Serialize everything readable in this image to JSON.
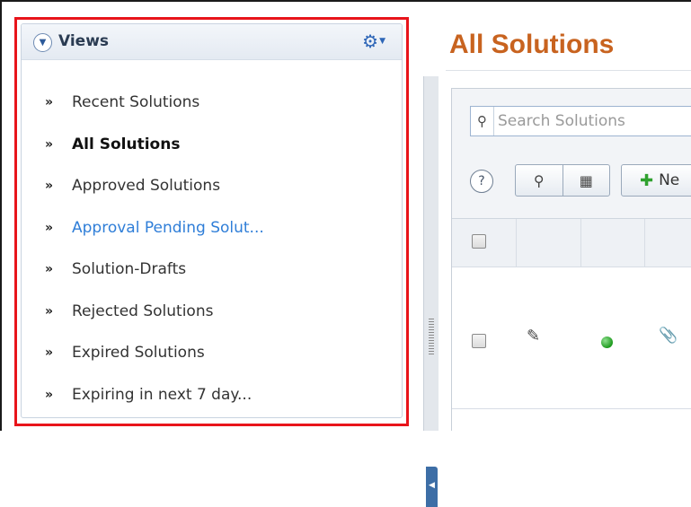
{
  "views": {
    "title": "Views",
    "collapse_icon": "chevron-down-icon",
    "settings_icon": "gear-icon",
    "items": [
      {
        "label": "Recent Solutions",
        "state": "normal"
      },
      {
        "label": "All Solutions",
        "state": "active"
      },
      {
        "label": "Approved Solutions",
        "state": "normal"
      },
      {
        "label": "Approval Pending Solut...",
        "state": "hover"
      },
      {
        "label": "Solution-Drafts",
        "state": "normal"
      },
      {
        "label": "Rejected Solutions",
        "state": "normal"
      },
      {
        "label": "Expired Solutions",
        "state": "normal"
      },
      {
        "label": "Expiring in next 7 day...",
        "state": "normal"
      }
    ],
    "bullet": "»"
  },
  "main": {
    "title": "All Solutions",
    "search": {
      "placeholder": "Search Solutions"
    },
    "toolbar": {
      "help": "?",
      "new_label": "Ne"
    }
  },
  "colors": {
    "highlight_border": "#e8141b",
    "title_orange": "#c8631f",
    "link_blue": "#2f7ed8",
    "status_green": "#1e9a1e"
  }
}
